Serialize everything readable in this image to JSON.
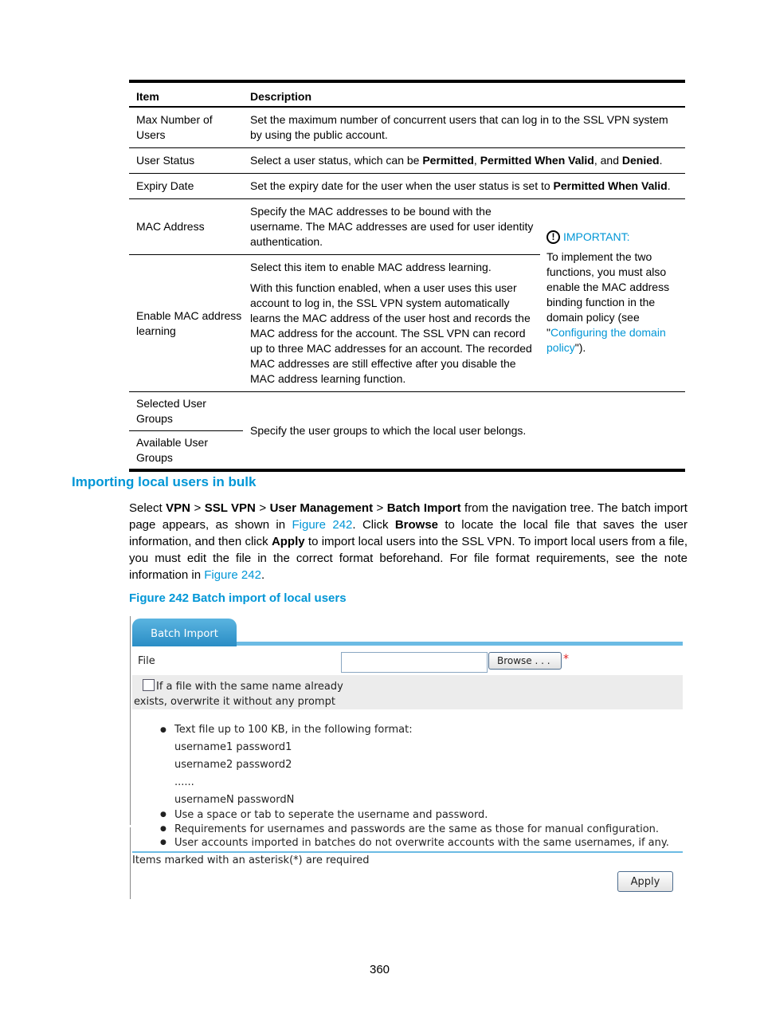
{
  "table": {
    "headers": [
      "Item",
      "Description"
    ],
    "rows": [
      {
        "item": "Max Number of Users",
        "desc": "Set the maximum number of concurrent users that can log in to the SSL VPN system by using the public account."
      },
      {
        "item": "User Status",
        "desc_pre": "Select a user status, which can be ",
        "b1": "Permitted",
        "sep1": ", ",
        "b2": "Permitted When Valid",
        "sep2": ", and ",
        "b3": "Denied",
        "end": "."
      },
      {
        "item": "Expiry Date",
        "desc_pre": "Set the expiry date for the user when the user status is set to ",
        "b1": "Permitted When Valid",
        "end": "."
      },
      {
        "item": "MAC Address",
        "desc": "Specify the MAC addresses to be bound with the username. The MAC addresses are used for user identity authentication."
      },
      {
        "item": "Enable MAC address learning",
        "desc1": "Select this item to enable MAC address learning.",
        "desc2": "With this function enabled, when a user uses this user account to log in, the SSL VPN system automatically learns the MAC address of the user host and records the MAC address for the account. The SSL VPN can record up to three MAC addresses for an account. The recorded MAC addresses are still effective after you disable the MAC address learning function."
      },
      {
        "item": "Selected User Groups"
      },
      {
        "item": "Available User Groups"
      }
    ],
    "groups_desc": "Specify the user groups to which the local user belongs.",
    "important": {
      "label": "IMPORTANT:",
      "icon": "!",
      "text_pre": "To implement the two functions, you must also enable the MAC address binding function in the domain policy (see \"",
      "link": "Configuring the domain policy",
      "text_post": "\")."
    }
  },
  "section": {
    "title": "Importing local users in bulk",
    "para": {
      "t1": "Select ",
      "b1": "VPN",
      "t2": " > ",
      "b2": "SSL VPN",
      "t3": " > ",
      "b3": "User Management",
      "t4": " > ",
      "b4": "Batch Import",
      "t5": " from the navigation tree. The batch import page appears, as shown in ",
      "l1": "Figure 242",
      "t6": ". Click ",
      "b5": "Browse",
      "t7": " to locate the local file that saves the user information, and then click ",
      "b6": "Apply",
      "t8": " to import local users into the SSL VPN. To import local users from a file, you must edit the file in the correct format beforehand. For file format requirements, see the note information in ",
      "l2": "Figure 242",
      "t9": "."
    },
    "figure_caption": "Figure 242 Batch import of local users"
  },
  "figure": {
    "tab_label": "Batch Import",
    "file_label": "File",
    "file_value": "",
    "browse_label": "Browse . . .",
    "required_mark": "*",
    "overwrite_checked": false,
    "overwrite_label": "If a file with the same name already exists, overwrite it without any prompt",
    "format_intro": "Text file up to 100 KB, in the following format:",
    "format_lines": [
      "username1 password1",
      "username2 password2",
      "......",
      "usernameN passwordN"
    ],
    "notes": [
      "Use a space or tab to seperate the username and password.",
      "Requirements for usernames and passwords are the same as those for manual configuration.",
      "User accounts imported in batches do not overwrite accounts with the same usernames, if any."
    ],
    "required_note": "Items marked with an asterisk(*) are required",
    "apply_label": "Apply"
  },
  "page_number": "360"
}
